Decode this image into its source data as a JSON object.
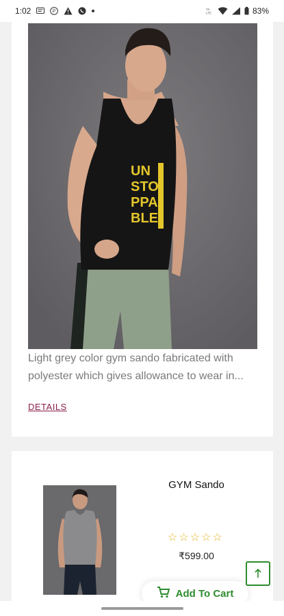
{
  "status_bar": {
    "time": "1:02",
    "battery": "83%"
  },
  "product_card": {
    "description": "Light grey color gym sando fabricated with polyester which gives allowance to wear in...",
    "details_label": "DETAILS",
    "hero_print": "UN STO PPA BLE"
  },
  "product_item": {
    "name": "GYM Sando",
    "rating": 0,
    "price": "₹599.00",
    "add_to_cart_label": "Add To Cart"
  },
  "colors": {
    "accent": "#2e8b2e",
    "details_link": "#8b1f4a",
    "star": "#e0b423"
  }
}
